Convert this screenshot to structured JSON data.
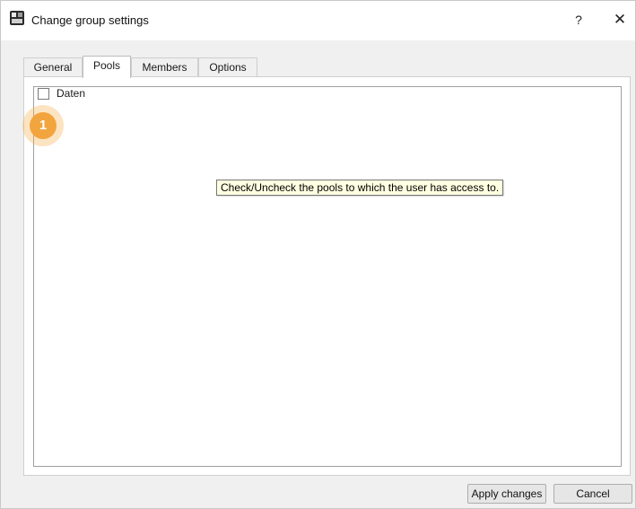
{
  "window": {
    "title": "Change group settings",
    "help_label": "?",
    "close_label": "✕"
  },
  "tabs": [
    {
      "label": "General",
      "active": false
    },
    {
      "label": "Pools",
      "active": true
    },
    {
      "label": "Members",
      "active": false
    },
    {
      "label": "Options",
      "active": false
    }
  ],
  "pools": {
    "items": [
      {
        "label": "Daten",
        "checked": false
      }
    ],
    "tooltip": "Check/Uncheck the pools to which the user has access to."
  },
  "annotation": {
    "step": "1",
    "color": "#f2a53e"
  },
  "buttons": {
    "apply_label": "Apply changes",
    "cancel_label": "Cancel"
  }
}
